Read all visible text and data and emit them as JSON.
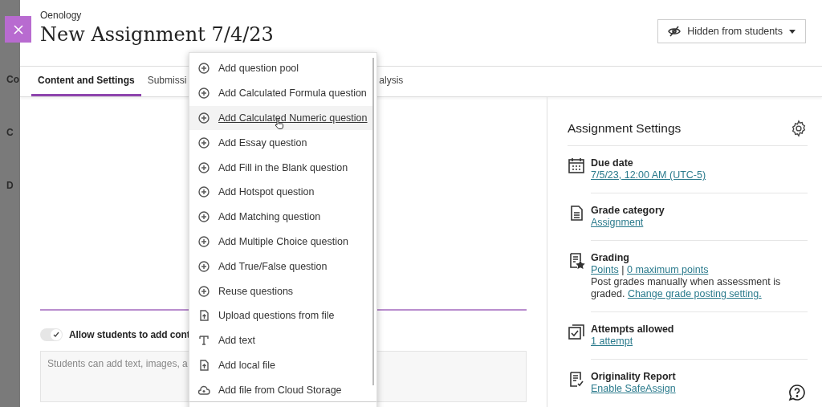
{
  "backdrop": {
    "letters": [
      "Co",
      "C",
      "D"
    ]
  },
  "header": {
    "course": "Oenology",
    "title": "New Assignment 7/4/23",
    "visibility": {
      "label": "Hidden from students"
    }
  },
  "tabs": [
    {
      "label": "Content and Settings",
      "selected": true
    },
    {
      "label": "Submissi",
      "selected": false
    },
    {
      "label": "alysis",
      "selected": false
    }
  ],
  "content": {
    "toggle": {
      "label": "Allow students to add cont",
      "on": true
    },
    "field": {
      "placeholder": "Students can add text, images, a"
    }
  },
  "menu": [
    {
      "kind": "add",
      "label": "Add question pool",
      "hovered": false
    },
    {
      "kind": "add",
      "label": "Add Calculated Formula question",
      "hovered": false
    },
    {
      "kind": "add",
      "label": "Add Calculated Numeric question",
      "hovered": true
    },
    {
      "kind": "add",
      "label": "Add Essay question",
      "hovered": false
    },
    {
      "kind": "add",
      "label": "Add Fill in the Blank question",
      "hovered": false
    },
    {
      "kind": "add",
      "label": "Add Hotspot question",
      "hovered": false
    },
    {
      "kind": "add",
      "label": "Add Matching question",
      "hovered": false
    },
    {
      "kind": "add",
      "label": "Add Multiple Choice question",
      "hovered": false
    },
    {
      "kind": "add",
      "label": "Add True/False question",
      "hovered": false
    },
    {
      "kind": "add",
      "label": "Reuse questions",
      "hovered": false
    },
    {
      "kind": "upload",
      "label": "Upload questions from file",
      "hovered": false
    },
    {
      "kind": "text",
      "label": "Add text",
      "hovered": false
    },
    {
      "kind": "upload",
      "label": "Add local file",
      "hovered": false
    },
    {
      "kind": "cloud",
      "label": "Add file from Cloud Storage",
      "hovered": false
    }
  ],
  "settings": {
    "title": "Assignment Settings",
    "items": [
      {
        "kind": "calendar",
        "label": "Due date",
        "lines": [
          [
            {
              "link": true,
              "text": "7/5/23, 12:00 AM (UTC-5)"
            }
          ]
        ]
      },
      {
        "kind": "document",
        "label": "Grade category",
        "lines": [
          [
            {
              "link": true,
              "text": "Assignment"
            }
          ]
        ]
      },
      {
        "kind": "grading",
        "label": "Grading",
        "lines": [
          [
            {
              "link": true,
              "text": "Points"
            },
            {
              "link": false,
              "text": "|"
            },
            {
              "link": true,
              "text": "0 maximum points"
            }
          ],
          [
            {
              "link": false,
              "text": "Post grades manually when assessment is graded."
            },
            {
              "link": true,
              "text": "Change grade posting setting."
            }
          ]
        ]
      },
      {
        "kind": "attempts",
        "label": "Attempts allowed",
        "lines": [
          [
            {
              "link": true,
              "text": "1 attempt"
            }
          ]
        ]
      },
      {
        "kind": "report",
        "label": "Originality Report",
        "lines": [
          [
            {
              "link": true,
              "text": "Enable SafeAssign"
            }
          ]
        ]
      }
    ]
  }
}
